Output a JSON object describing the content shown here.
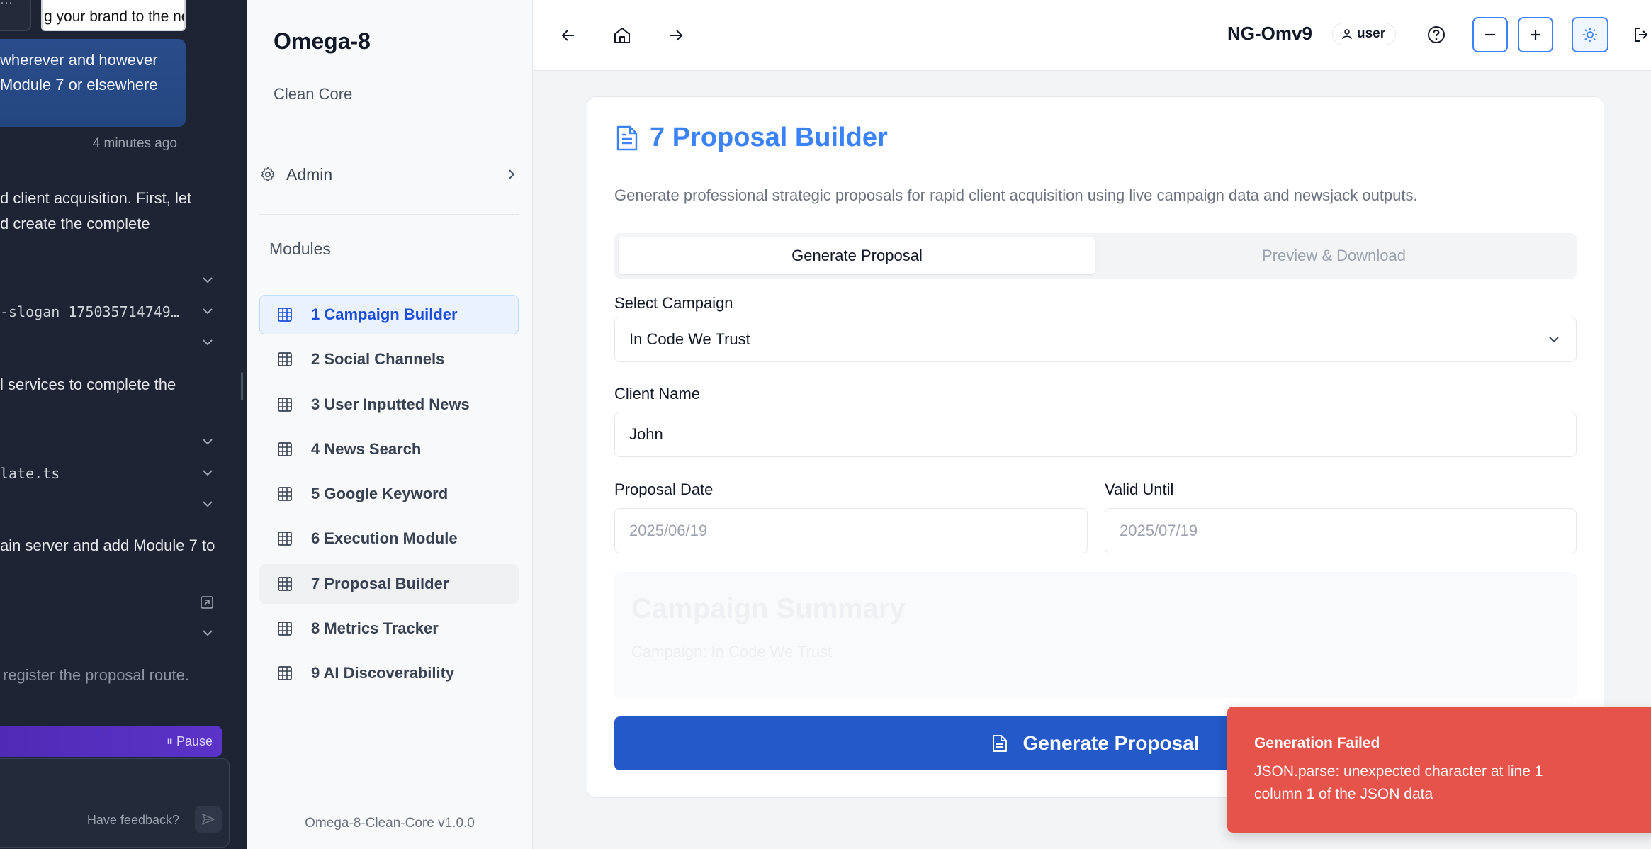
{
  "chat": {
    "thumb1_text": "⋯",
    "thumb2_text": "g your brand to the ne",
    "user_message": [
      "wherever and however",
      "Module 7 or elsewhere"
    ],
    "timestamp": "4 minutes ago",
    "lines": [
      "d client acquisition. First, let",
      "d create the complete"
    ],
    "file1": "-slogan_175035714749…",
    "text2": "l services to complete the",
    "file2": "late.ts",
    "text3": "ain server and add Module 7 to",
    "muted": "register the proposal route.",
    "pause_label": "Pause",
    "feedback_label": "Have feedback?"
  },
  "sidebar": {
    "brand": "Omega-8",
    "subtitle": "Clean Core",
    "admin_label": "Admin",
    "modules_title": "Modules",
    "items": [
      {
        "label": "1 Campaign Builder"
      },
      {
        "label": "2 Social Channels"
      },
      {
        "label": "3 User Inputted News"
      },
      {
        "label": "4 News Search"
      },
      {
        "label": "5 Google Keyword"
      },
      {
        "label": "6 Execution Module"
      },
      {
        "label": "7 Proposal Builder"
      },
      {
        "label": "8 Metrics Tracker"
      },
      {
        "label": "9 AI Discoverability"
      }
    ],
    "version": "Omega-8-Clean-Core v1.0.0"
  },
  "topbar": {
    "instance_code": "NG-Omv9",
    "role": "user"
  },
  "main": {
    "title": "7 Proposal Builder",
    "description": "Generate professional strategic proposals for rapid client acquisition using live campaign data and newsjack outputs.",
    "tabs": [
      {
        "label": "Generate Proposal"
      },
      {
        "label": "Preview & Download"
      }
    ],
    "campaign_label": "Select Campaign",
    "campaign_value": "In Code We Trust",
    "client_label": "Client Name",
    "client_value": "John",
    "date_label": "Proposal Date",
    "date_placeholder": "2025/06/19",
    "valid_label": "Valid Until",
    "valid_placeholder": "2025/07/19",
    "summary_title": "Campaign Summary",
    "summary_text": "Campaign: In Code We Trust",
    "generate_label": "Generate Proposal"
  },
  "toast": {
    "title": "Generation Failed",
    "message": "JSON.parse: unexpected character at line 1 column 1 of the JSON data"
  },
  "colors": {
    "accent": "#3b82f6",
    "primary_button": "#2459c9",
    "error": "#e5534b"
  }
}
